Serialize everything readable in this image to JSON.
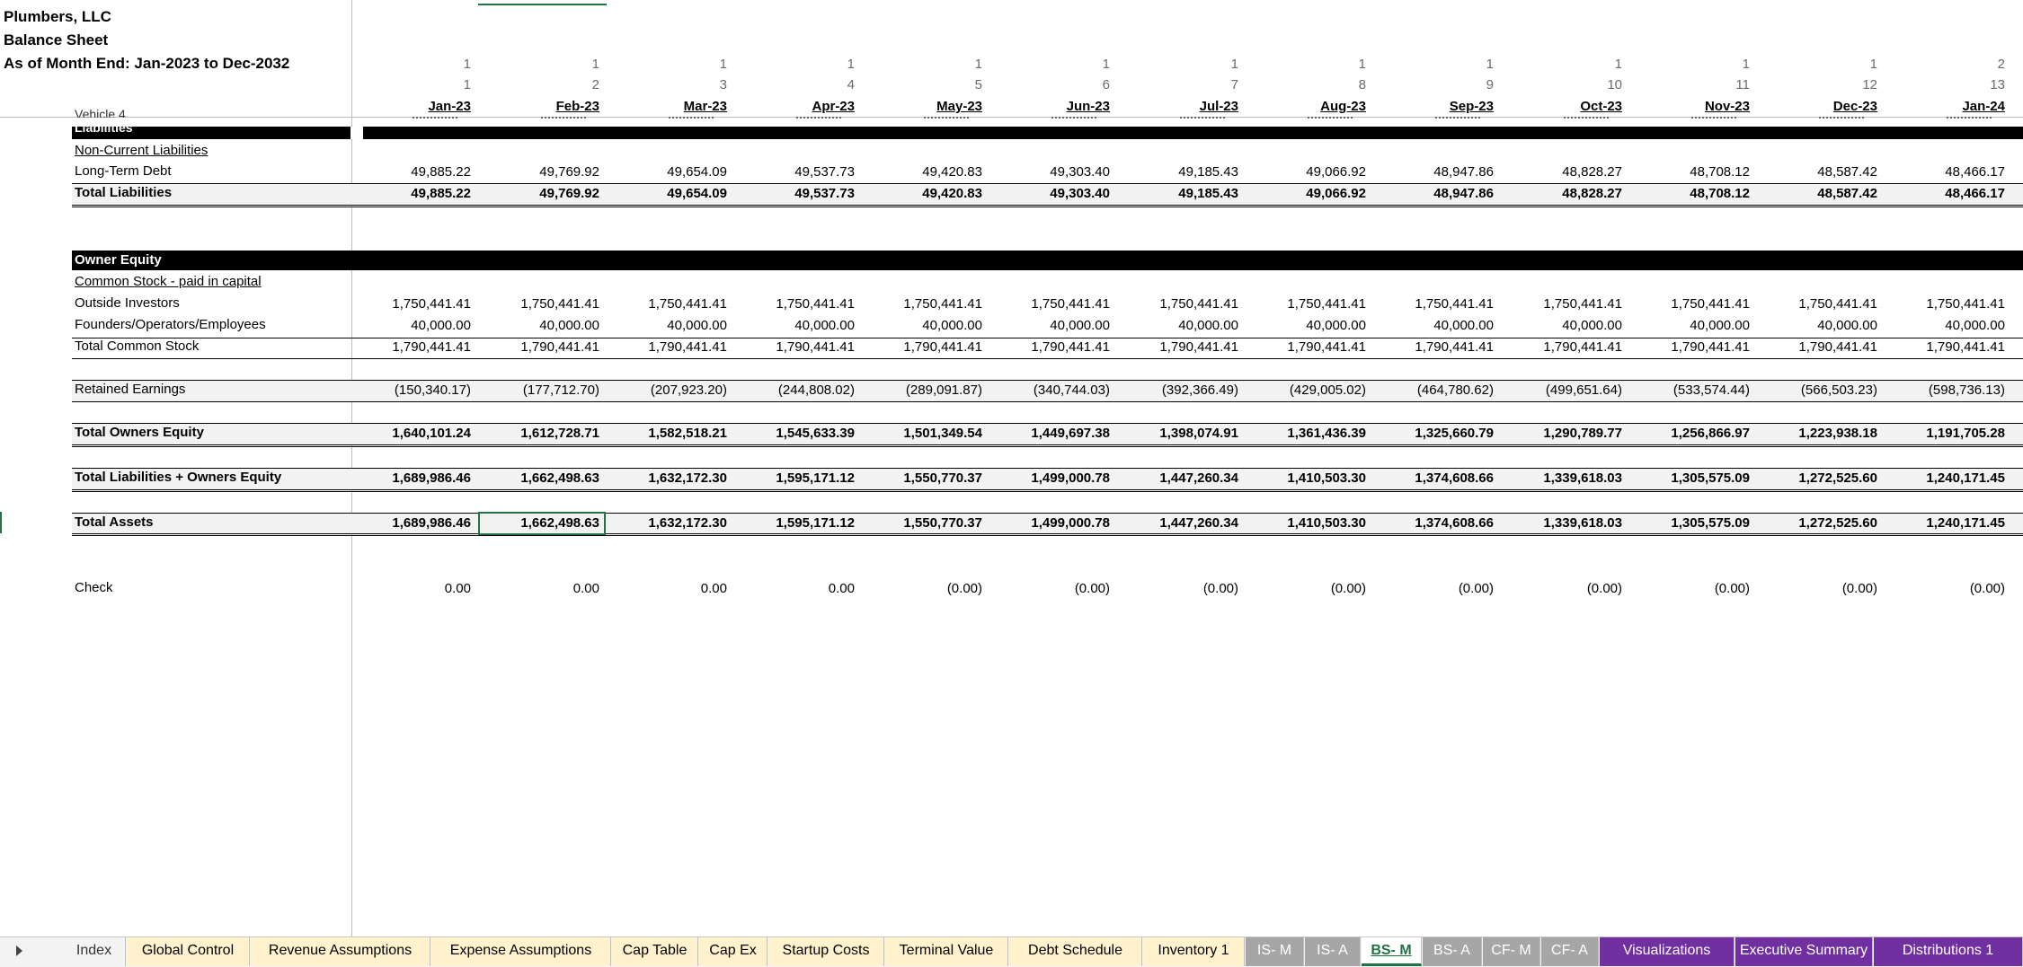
{
  "sheet": {
    "company": "Plumbers, LLC",
    "statement": "Balance Sheet",
    "period": "As of Month End: Jan-2023 to Dec-2032",
    "partial_row_label": "Vehicle 4"
  },
  "columns": {
    "year_index": [
      "1",
      "1",
      "1",
      "1",
      "1",
      "1",
      "1",
      "1",
      "1",
      "1",
      "1",
      "1",
      "2"
    ],
    "month_index": [
      "1",
      "2",
      "3",
      "4",
      "5",
      "6",
      "7",
      "8",
      "9",
      "10",
      "11",
      "12",
      "13"
    ],
    "months": [
      "Jan-23",
      "Feb-23",
      "Mar-23",
      "Apr-23",
      "May-23",
      "Jun-23",
      "Jul-23",
      "Aug-23",
      "Sep-23",
      "Oct-23",
      "Nov-23",
      "Dec-23",
      "Jan-24"
    ]
  },
  "sections": {
    "liabilities": "Liabilities",
    "non_current": "Non-Current Liabilities",
    "owner_equity": "Owner Equity",
    "common_stock": "Common Stock - paid in capital"
  },
  "rows": {
    "long_term_debt": {
      "label": "Long-Term Debt",
      "values": [
        "49,885.22",
        "49,769.92",
        "49,654.09",
        "49,537.73",
        "49,420.83",
        "49,303.40",
        "49,185.43",
        "49,066.92",
        "48,947.86",
        "48,828.27",
        "48,708.12",
        "48,587.42",
        "48,466.17"
      ]
    },
    "total_liabilities": {
      "label": "Total Liabilities",
      "values": [
        "49,885.22",
        "49,769.92",
        "49,654.09",
        "49,537.73",
        "49,420.83",
        "49,303.40",
        "49,185.43",
        "49,066.92",
        "48,947.86",
        "48,828.27",
        "48,708.12",
        "48,587.42",
        "48,466.17"
      ]
    },
    "outside_investors": {
      "label": "Outside Investors",
      "values": [
        "1,750,441.41",
        "1,750,441.41",
        "1,750,441.41",
        "1,750,441.41",
        "1,750,441.41",
        "1,750,441.41",
        "1,750,441.41",
        "1,750,441.41",
        "1,750,441.41",
        "1,750,441.41",
        "1,750,441.41",
        "1,750,441.41",
        "1,750,441.41"
      ]
    },
    "founders": {
      "label": "Founders/Operators/Employees",
      "values": [
        "40,000.00",
        "40,000.00",
        "40,000.00",
        "40,000.00",
        "40,000.00",
        "40,000.00",
        "40,000.00",
        "40,000.00",
        "40,000.00",
        "40,000.00",
        "40,000.00",
        "40,000.00",
        "40,000.00"
      ]
    },
    "total_common_stock": {
      "label": "Total Common Stock",
      "values": [
        "1,790,441.41",
        "1,790,441.41",
        "1,790,441.41",
        "1,790,441.41",
        "1,790,441.41",
        "1,790,441.41",
        "1,790,441.41",
        "1,790,441.41",
        "1,790,441.41",
        "1,790,441.41",
        "1,790,441.41",
        "1,790,441.41",
        "1,790,441.41"
      ]
    },
    "retained_earnings": {
      "label": "Retained Earnings",
      "values": [
        "(150,340.17)",
        "(177,712.70)",
        "(207,923.20)",
        "(244,808.02)",
        "(289,091.87)",
        "(340,744.03)",
        "(392,366.49)",
        "(429,005.02)",
        "(464,780.62)",
        "(499,651.64)",
        "(533,574.44)",
        "(566,503.23)",
        "(598,736.13)"
      ]
    },
    "total_owners_equity": {
      "label": "Total Owners Equity",
      "values": [
        "1,640,101.24",
        "1,612,728.71",
        "1,582,518.21",
        "1,545,633.39",
        "1,501,349.54",
        "1,449,697.38",
        "1,398,074.91",
        "1,361,436.39",
        "1,325,660.79",
        "1,290,789.77",
        "1,256,866.97",
        "1,223,938.18",
        "1,191,705.28"
      ]
    },
    "total_liab_equity": {
      "label": "Total Liabilities + Owners Equity",
      "values": [
        "1,689,986.46",
        "1,662,498.63",
        "1,632,172.30",
        "1,595,171.12",
        "1,550,770.37",
        "1,499,000.78",
        "1,447,260.34",
        "1,410,503.30",
        "1,374,608.66",
        "1,339,618.03",
        "1,305,575.09",
        "1,272,525.60",
        "1,240,171.45"
      ]
    },
    "total_assets": {
      "label": "Total Assets",
      "values": [
        "1,689,986.46",
        "1,662,498.63",
        "1,632,172.30",
        "1,595,171.12",
        "1,550,770.37",
        "1,499,000.78",
        "1,447,260.34",
        "1,410,503.30",
        "1,374,608.66",
        "1,339,618.03",
        "1,305,575.09",
        "1,272,525.60",
        "1,240,171.45"
      ]
    },
    "check": {
      "label": "Check",
      "values": [
        "0.00",
        "0.00",
        "0.00",
        "0.00",
        "(0.00)",
        "(0.00)",
        "(0.00)",
        "(0.00)",
        "(0.00)",
        "(0.00)",
        "(0.00)",
        "(0.00)",
        "(0.00)"
      ]
    }
  },
  "tabs": [
    {
      "label": "Index",
      "bg": "#f3f3f3",
      "fg": "#333333"
    },
    {
      "label": "Global Control",
      "bg": "#fff2cc",
      "fg": "#000000"
    },
    {
      "label": "Revenue Assumptions",
      "bg": "#fff2cc",
      "fg": "#000000"
    },
    {
      "label": "Expense Assumptions",
      "bg": "#fff2cc",
      "fg": "#000000"
    },
    {
      "label": "Cap Table",
      "bg": "#fff2cc",
      "fg": "#000000"
    },
    {
      "label": "Cap Ex",
      "bg": "#fff2cc",
      "fg": "#000000"
    },
    {
      "label": "Startup Costs",
      "bg": "#fff2cc",
      "fg": "#000000"
    },
    {
      "label": "Terminal Value",
      "bg": "#fff2cc",
      "fg": "#000000"
    },
    {
      "label": "Debt Schedule",
      "bg": "#fff2cc",
      "fg": "#000000"
    },
    {
      "label": "Inventory 1",
      "bg": "#fff2cc",
      "fg": "#000000"
    },
    {
      "label": "IS- M",
      "bg": "#a6a6a6",
      "fg": "#ffffff"
    },
    {
      "label": "IS- A",
      "bg": "#a6a6a6",
      "fg": "#ffffff"
    },
    {
      "label": "BS- M",
      "bg": "#ffffff",
      "fg": "#217346"
    },
    {
      "label": "BS- A",
      "bg": "#a6a6a6",
      "fg": "#ffffff"
    },
    {
      "label": "CF- M",
      "bg": "#a6a6a6",
      "fg": "#ffffff"
    },
    {
      "label": "CF- A",
      "bg": "#a6a6a6",
      "fg": "#ffffff"
    },
    {
      "label": "Visualizations",
      "bg": "#7030a0",
      "fg": "#ffffff"
    },
    {
      "label": "Executive Summary",
      "bg": "#7030a0",
      "fg": "#ffffff"
    },
    {
      "label": "Distributions 1",
      "bg": "#7030a0",
      "fg": "#ffffff"
    }
  ],
  "colors": {
    "accent": "#217346",
    "purple": "#7030a0",
    "gray_tab": "#a6a6a6",
    "yellow_tab": "#fff2cc"
  }
}
